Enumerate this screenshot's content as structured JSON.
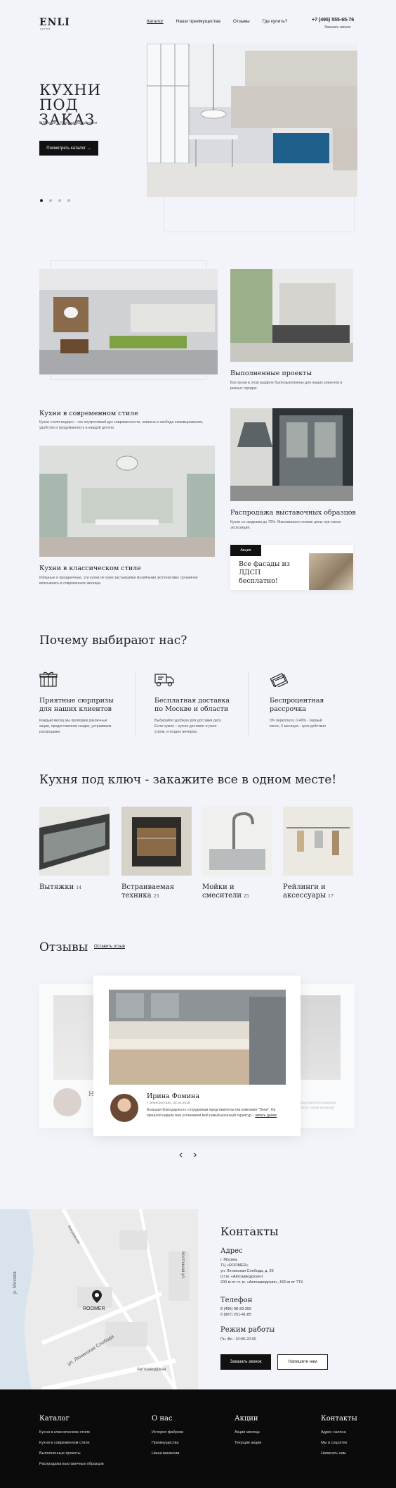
{
  "header": {
    "logo": "ENLI",
    "logo_sub": "кухни",
    "nav": [
      "Каталог",
      "Наши преимущества",
      "Отзывы",
      "Где купить?"
    ],
    "phone": "+7 (495) 555-65-76",
    "order_call": "Заказать звонок"
  },
  "hero": {
    "title": "КУХНИ ПОД ЗАКАЗ",
    "subtitle": "В Москве и Московской области",
    "button": "Посмотреть каталог  →"
  },
  "catalog": {
    "modern": {
      "title": "Кухни в современном стиле",
      "text": "Кухни стиля модерн – это неукротимый дух современности, новизна и свобода самовыражения, удобство и продуманность в каждой детали."
    },
    "done": {
      "title": "Выполненные проекты",
      "text": "Все кухни в этом разделе были выполнены для наших клиентов в разных городах."
    },
    "classic": {
      "title": "Кухни в классическом стиле",
      "text": "Изящные и празднечные, эти кухни не хуже застывшими музейными экспонатами: органично вписываясь в современное жилище."
    },
    "sale": {
      "title": "Распродажа выставочных образцов",
      "text": "Кухни со скидками до 70%. Максимально низкие цены при смене экспозиции."
    },
    "promo": {
      "badge": "Акция",
      "text": "Все фасады из ЛДСП бесплатно!"
    }
  },
  "why": {
    "title": "Почему выбирают нас?",
    "items": [
      {
        "icon": "gift-icon",
        "title": "Приятные сюрпризы для наших клиентов",
        "text": "Каждый месяц мы проводим различные акции, предоставляем скидки, устраиваем распродажи."
      },
      {
        "icon": "truck-icon",
        "title": "Бесплатная доставка по Москве и области",
        "text": "Выбирайте удобную для доставки дату. Если нужно – кухню доставят и рано утром, и поздно вечером."
      },
      {
        "icon": "card-icon",
        "title": "Беспроцентная рассрочка",
        "text": "0% переплата. 0-40% - первый взнос, 6 месяцев - срок действия"
      }
    ]
  },
  "turnkey": {
    "title": "Кухня под ключ - закажите все в одном месте!",
    "items": [
      {
        "label": "Вытяжки",
        "count": "14"
      },
      {
        "label": "Встраиваемая техника",
        "count": "23"
      },
      {
        "label": "Мойки и смесители",
        "count": "25"
      },
      {
        "label": "Рейлинги и аксессуары",
        "count": "17"
      }
    ]
  },
  "reviews": {
    "title": "Отзывы",
    "leave": "Оставить отзыв",
    "name": "Ирина Фомина",
    "meta": "г. Электросталь, 22.01.2019",
    "text": "Большая благодарность сотрудникам представительства компании \"Энли\". На прошлой неделе мне установили мой новый кухонный гарнитур...",
    "more": "читать далее",
    "side_text": "представителя компании \"Энли\" новый кухонный",
    "side_initial": "Н",
    "prev": "‹",
    "next": "›"
  },
  "contacts": {
    "title": "Контакты",
    "address_label": "Адрес",
    "address": [
      "г. Москва,",
      "ТЦ «ROOMER»",
      "ул. Ленинская Слобода, д. 26",
      "(ст.м. «Автозаводская»)",
      "200 м от ст. м. «Автозаводская», 500 м от ТТК"
    ],
    "phone_label": "Телефон",
    "phones": [
      "8 (495) 98-33-206",
      "8 (967) 251-41-85"
    ],
    "hours_label": "Режим работы",
    "hours": "Пн.-Вс.: 10:00-22:00",
    "btn_call": "Заказать звонок",
    "btn_write": "Напишите нам",
    "map_labels": {
      "moscow": "р. Москва",
      "roomer": "ROOMER",
      "street1": "ул. Ленинская Слобода",
      "street2": "Восточная ул.",
      "street3": "Автозаводская",
      "street4": "Кожуховская"
    }
  },
  "footer": {
    "cols": [
      {
        "head": "Каталог",
        "links": [
          "Кухни в классическом стиле",
          "Кухни в современном стиле",
          "Выполненные проекты",
          "Распродажа выставочных образцов"
        ]
      },
      {
        "head": "О нас",
        "links": [
          "История фабрики",
          "Преимущества",
          "Наши вакансии"
        ]
      },
      {
        "head": "Акции",
        "links": [
          "Акции месяца",
          "Текущие акции"
        ]
      },
      {
        "head": "Контакты",
        "links": [
          "Адрес салона",
          "Мы в соцсетях",
          "Написать нам"
        ]
      }
    ]
  }
}
